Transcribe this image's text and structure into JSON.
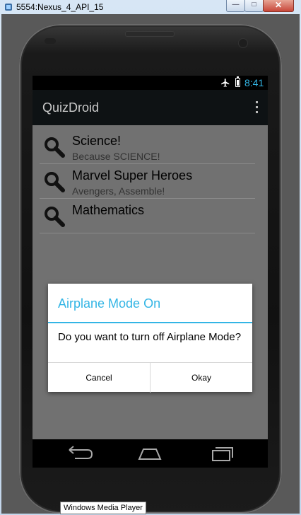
{
  "window": {
    "title": "5554:Nexus_4_API_15",
    "minimize_glyph": "—",
    "maximize_glyph": "□",
    "close_glyph": "✕"
  },
  "status_bar": {
    "time": "8:41",
    "icons": [
      "airplane-icon",
      "battery-icon"
    ]
  },
  "action_bar": {
    "title": "QuizDroid",
    "overflow_icon": "overflow-menu-icon"
  },
  "quiz_list": [
    {
      "title": "Science!",
      "subtitle": "Because SCIENCE!",
      "icon": "search-icon"
    },
    {
      "title": "Marvel Super Heroes",
      "subtitle": "Avengers, Assemble!",
      "icon": "search-icon"
    },
    {
      "title": "Mathematics",
      "subtitle": "",
      "icon": "search-icon"
    }
  ],
  "dialog": {
    "title": "Airplane Mode On",
    "message": "Do you want to turn off Airplane Mode?",
    "cancel_label": "Cancel",
    "okay_label": "Okay"
  },
  "nav_bar": {
    "icons": [
      "back-icon",
      "home-icon",
      "recent-apps-icon"
    ]
  },
  "tooltip": {
    "text": "Windows Media Player"
  },
  "colors": {
    "accent": "#33b5e5",
    "dim_content": "#717171",
    "action_bar": "#0e1214"
  }
}
